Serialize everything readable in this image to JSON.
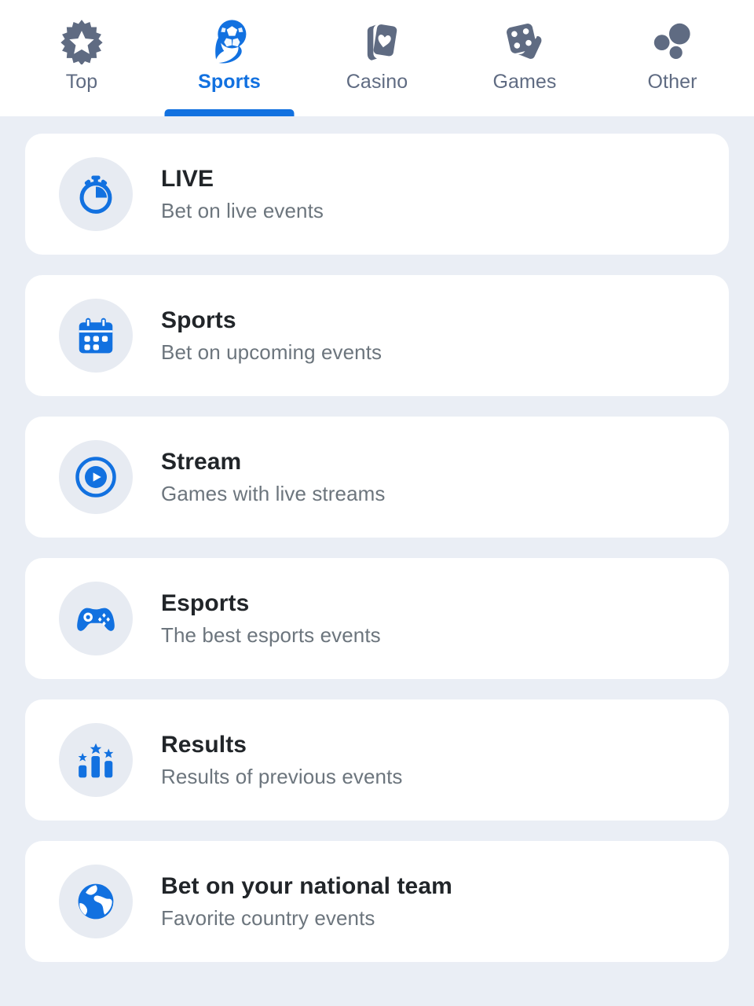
{
  "theme": {
    "accent": "#1271e0",
    "page_bg": "#eaeef5",
    "card_bg": "#ffffff",
    "icon_circle_bg": "#e7ebf2",
    "tab_inactive": "#5f6b82",
    "title_color": "#212529",
    "subtitle_color": "#6c757d"
  },
  "tabs": [
    {
      "label": "Top",
      "icon": "starburst-badge-icon",
      "active": false
    },
    {
      "label": "Sports",
      "icon": "soccer-ball-icon",
      "active": true
    },
    {
      "label": "Casino",
      "icon": "playing-cards-heart-icon",
      "active": false
    },
    {
      "label": "Games",
      "icon": "dice-icon",
      "active": false
    },
    {
      "label": "Other",
      "icon": "three-circles-icon",
      "active": false
    }
  ],
  "menu": [
    {
      "title": "LIVE",
      "subtitle": "Bet on live events",
      "icon": "stopwatch-icon"
    },
    {
      "title": "Sports",
      "subtitle": "Bet on upcoming events",
      "icon": "calendar-icon"
    },
    {
      "title": "Stream",
      "subtitle": "Games with live streams",
      "icon": "play-circle-icon"
    },
    {
      "title": "Esports",
      "subtitle": "The best esports events",
      "icon": "gamepad-icon"
    },
    {
      "title": "Results",
      "subtitle": "Results of previous events",
      "icon": "podium-stars-icon"
    },
    {
      "title": "Bet on your national team",
      "subtitle": "Favorite country events",
      "icon": "globe-icon"
    }
  ]
}
